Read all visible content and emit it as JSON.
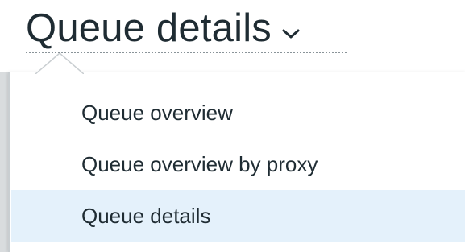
{
  "header": {
    "title": "Queue details",
    "caret_icon": "chevron-down-icon"
  },
  "dropdown": {
    "items": [
      {
        "label": "Queue overview",
        "selected": false
      },
      {
        "label": "Queue overview by proxy",
        "selected": false
      },
      {
        "label": "Queue details",
        "selected": true
      }
    ]
  },
  "colors": {
    "text": "#1f2c33",
    "selected_bg": "#e4f1fb",
    "underline": "#8a9499"
  }
}
